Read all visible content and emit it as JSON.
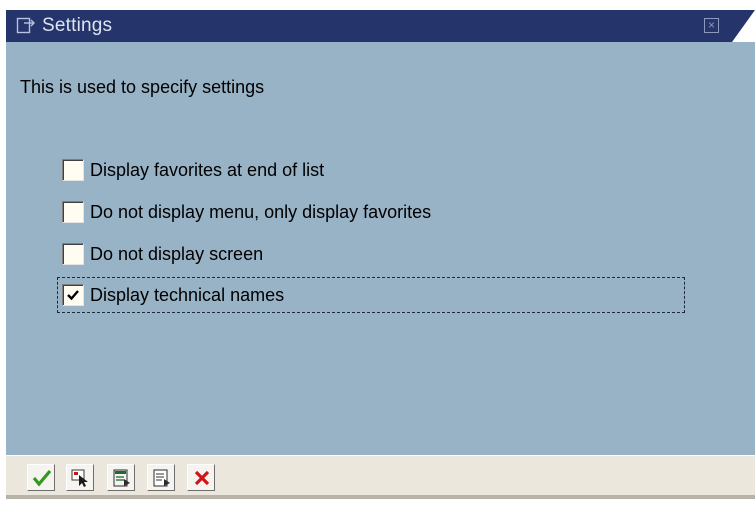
{
  "window": {
    "title": "Settings",
    "title_icon": "settings-popup-icon",
    "close_icon": "close-icon",
    "close_glyph": "×"
  },
  "description": "This is used to specify settings",
  "options": [
    {
      "label": "Display favorites at end of list",
      "checked": false
    },
    {
      "label": "Do not display menu, only display favorites",
      "checked": false
    },
    {
      "label": "Do not display screen",
      "checked": false
    },
    {
      "label": "Display technical names",
      "checked": true,
      "focused": true
    }
  ],
  "toolbar": {
    "buttons": [
      {
        "icon": "green-checkmark-icon"
      },
      {
        "icon": "select-cursor-icon"
      },
      {
        "icon": "document-save-icon"
      },
      {
        "icon": "document-open-icon"
      },
      {
        "icon": "red-cancel-x-icon"
      }
    ]
  },
  "colors": {
    "titlebar": "#25346a",
    "body": "#98b2c6",
    "footer": "#ebe7dc",
    "accept": "#2f9a1d",
    "cancel": "#d0141a"
  }
}
